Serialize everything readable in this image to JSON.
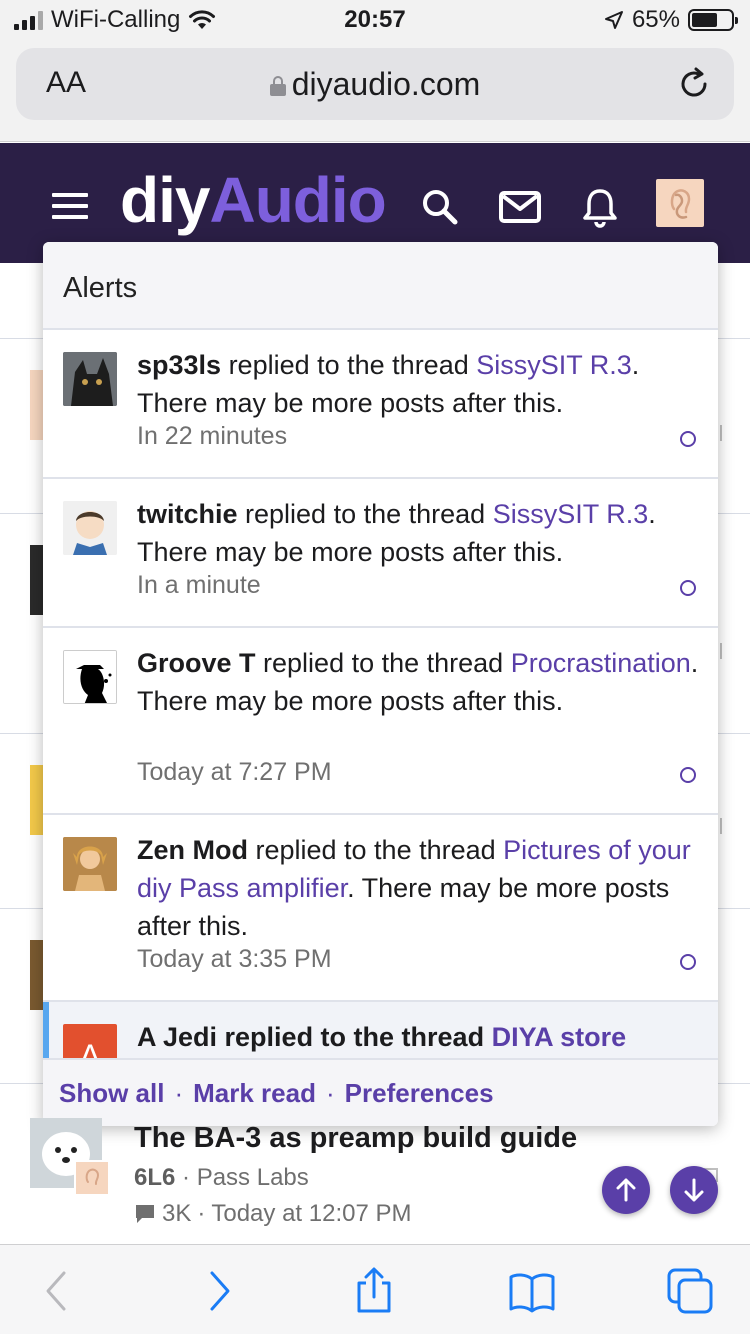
{
  "status_bar": {
    "carrier": "WiFi-Calling",
    "time": "20:57",
    "battery": "65%",
    "battery_level": 0.65
  },
  "browser": {
    "aa_label": "AA",
    "url": "diyaudio.com"
  },
  "site": {
    "logo_diy": "diy",
    "logo_audio": "Audio"
  },
  "alerts": {
    "title": "Alerts",
    "items": [
      {
        "user": "sp33ls",
        "action": " replied to the thread ",
        "thread": "SissySIT R.3",
        "suffix": ". There may be more posts after this.",
        "time": "In 22 minutes"
      },
      {
        "user": "twitchie",
        "action": " replied to the thread ",
        "thread": "SissySIT R.3",
        "suffix": ". There may be more posts after this.",
        "time": "In a minute"
      },
      {
        "user": "Groove T",
        "action": " replied to the thread ",
        "thread": "Procrastination",
        "suffix": ". There may be more posts after this.",
        "time": "Today at 7:27 PM"
      },
      {
        "user": "Zen Mod",
        "action": " replied to the thread ",
        "thread": "Pictures of your diy Pass amplifier",
        "suffix": ". There may be more posts after this.",
        "time": "Today at 3:35 PM"
      },
      {
        "user": "A Jedi",
        "avatar_letter": "A",
        "action": " replied to the thread ",
        "thread": "DIYA store",
        "suffix": ""
      }
    ],
    "footer": {
      "show_all": "Show all",
      "mark_read": "Mark read",
      "preferences": "Preferences",
      "separator": "·"
    }
  },
  "thread": {
    "title": "The BA-3 as preamp build guide",
    "author": "6L6",
    "separator": "·",
    "forum": "Pass Labs",
    "replies": "3K",
    "last_post": "Today at 12:07 PM"
  },
  "icons": {
    "accent": "#5a3fa8",
    "header_bg": "#2b1f46",
    "unread_bar": "#58a7ef"
  }
}
